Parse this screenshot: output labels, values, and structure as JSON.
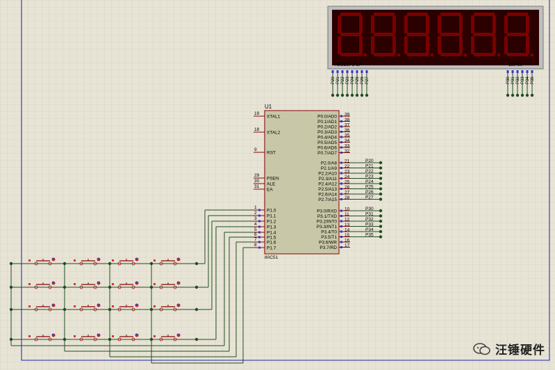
{
  "display": {
    "segment_label": "ABCDEFG  DP",
    "digit_label": "123456",
    "segment_pins": [
      "P20",
      "P21",
      "P22",
      "P23",
      "P24",
      "P25",
      "P26",
      "P27"
    ],
    "digit_pins": [
      "P30",
      "P31",
      "P32",
      "P33",
      "P34",
      "P35"
    ]
  },
  "mcu": {
    "ref": "U1",
    "part": "80C51",
    "left_pins": [
      {
        "num": "19",
        "name": "XTAL1"
      },
      {
        "num": "18",
        "name": "XTAL2"
      },
      {
        "num": "9",
        "name": "RST"
      },
      {
        "num": "29",
        "name": "PSEN"
      },
      {
        "num": "30",
        "name": "ALE"
      },
      {
        "num": "31",
        "name": "EA"
      },
      {
        "num": "1",
        "name": "P1.0"
      },
      {
        "num": "2",
        "name": "P1.1"
      },
      {
        "num": "3",
        "name": "P1.2"
      },
      {
        "num": "4",
        "name": "P1.3"
      },
      {
        "num": "5",
        "name": "P1.4"
      },
      {
        "num": "6",
        "name": "P1.5"
      },
      {
        "num": "7",
        "name": "P1.6"
      },
      {
        "num": "8",
        "name": "P1.7"
      }
    ],
    "port0": [
      {
        "num": "39",
        "name": "P0.0/AD0"
      },
      {
        "num": "38",
        "name": "P0.1/AD1"
      },
      {
        "num": "37",
        "name": "P0.2/AD2"
      },
      {
        "num": "36",
        "name": "P0.3/AD3"
      },
      {
        "num": "35",
        "name": "P0.4/AD4"
      },
      {
        "num": "34",
        "name": "P0.5/AD5"
      },
      {
        "num": "33",
        "name": "P0.6/AD6"
      },
      {
        "num": "32",
        "name": "P0.7/AD7"
      }
    ],
    "port2": [
      {
        "num": "21",
        "name": "P2.0/A8",
        "net": "P20"
      },
      {
        "num": "22",
        "name": "P2.1/A9",
        "net": "P21"
      },
      {
        "num": "23",
        "name": "P2.2/A10",
        "net": "P22"
      },
      {
        "num": "24",
        "name": "P2.3/A11",
        "net": "P23"
      },
      {
        "num": "25",
        "name": "P2.4/A12",
        "net": "P24"
      },
      {
        "num": "26",
        "name": "P2.5/A13",
        "net": "P25"
      },
      {
        "num": "27",
        "name": "P2.6/A14",
        "net": "P26"
      },
      {
        "num": "28",
        "name": "P2.7/A15",
        "net": "P27"
      }
    ],
    "port3": [
      {
        "num": "10",
        "name": "P3.0/RXD",
        "net": "P30"
      },
      {
        "num": "11",
        "name": "P3.1/TXD",
        "net": "P31"
      },
      {
        "num": "12",
        "name": "P3.2/INT0",
        "net": "P32"
      },
      {
        "num": "13",
        "name": "P3.3/INT1",
        "net": "P33"
      },
      {
        "num": "14",
        "name": "P3.4/T0",
        "net": "P34"
      },
      {
        "num": "15",
        "name": "P3.5/T1",
        "net": "P35"
      },
      {
        "num": "16",
        "name": "P3.6/WR",
        "net": ""
      },
      {
        "num": "17",
        "name": "P3.7/RD",
        "net": ""
      }
    ]
  },
  "keypad": {
    "rows": 4,
    "cols": 4
  },
  "watermark": {
    "text": "汪锤硬件"
  },
  "colors": {
    "wire": "#1f4d1f",
    "chip": "#c8c8a8",
    "chip_border": "#8b0000",
    "segment_off": "#7a0000",
    "display_bg": "#2a0000",
    "pin_marker": "#3333cc"
  }
}
